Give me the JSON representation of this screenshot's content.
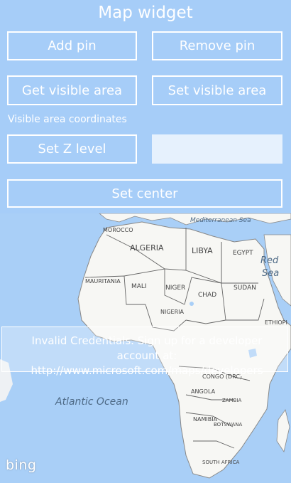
{
  "title": "Map widget",
  "buttons": {
    "add_pin": "Add pin",
    "remove_pin": "Remove pin",
    "get_visible_area": "Get visible area",
    "set_visible_area": "Set visible area",
    "set_z_level": "Set Z level",
    "set_center": "Set center"
  },
  "coordinates_label": "Visible area coordinates",
  "z_level_input": {
    "value": "",
    "placeholder": ""
  },
  "map": {
    "oceans": {
      "atlantic": "Atlantic Ocean",
      "mediterranean": "Mediterranean Sea",
      "red_sea_line1": "Red",
      "red_sea_line2": "Sea"
    },
    "countries": {
      "morocco": "MOROCCO",
      "algeria": "ALGERIA",
      "libya": "LIBYA",
      "egypt": "EGYPT",
      "mauritania": "MAURITANIA",
      "mali": "MALI",
      "niger": "NIGER",
      "chad": "CHAD",
      "sudan": "SUDAN",
      "nigeria": "NIGERIA",
      "ethiopia": "ETHIOPI",
      "dr_congo": "CONGO (DRC)",
      "angola": "ANGOLA",
      "zambia": "ZAMBIA",
      "namibia": "NAMIBIA",
      "botswana": "BOTSWANA",
      "south_africa": "SOUTH AFRICA"
    },
    "credentials_message": "Invalid Credentials. Sign up for a developer account at: http://www.microsoft.com/maps/developers",
    "logo": "bing"
  },
  "colors": {
    "panel_background": "#a6cdf8",
    "water": "#a9cff7",
    "land": "#f7f7f4",
    "border": "#555555"
  }
}
